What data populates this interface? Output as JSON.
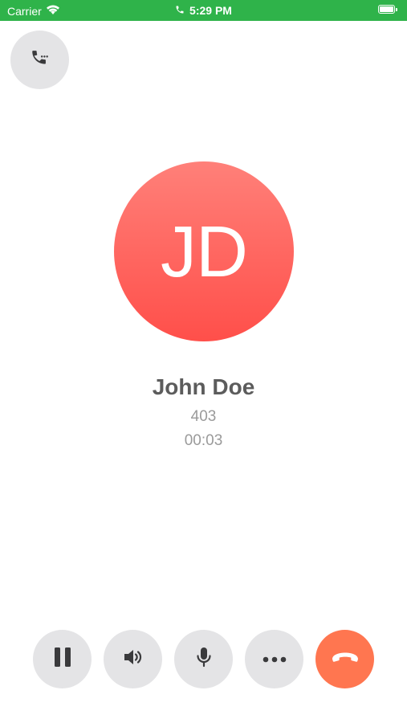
{
  "status_bar": {
    "carrier": "Carrier",
    "time": "5:29 PM",
    "icons": [
      "wifi-icon",
      "phone-icon",
      "battery-icon"
    ],
    "background_color": "#2fb34a"
  },
  "call": {
    "initials": "JD",
    "name": "John Doe",
    "number": "403",
    "duration": "00:03"
  },
  "controls": {
    "dialpad": "dialpad-phone-icon",
    "hold": "pause-icon",
    "speaker": "speaker-icon",
    "mute": "microphone-icon",
    "more": "more-dots-icon",
    "end_call": "hangup-icon"
  },
  "colors": {
    "avatar_top": "#ff8079",
    "avatar_bottom": "#ff4f4a",
    "end_call": "#ff7650",
    "control_bg": "#e4e4e6",
    "icon": "#3a3a3c"
  }
}
